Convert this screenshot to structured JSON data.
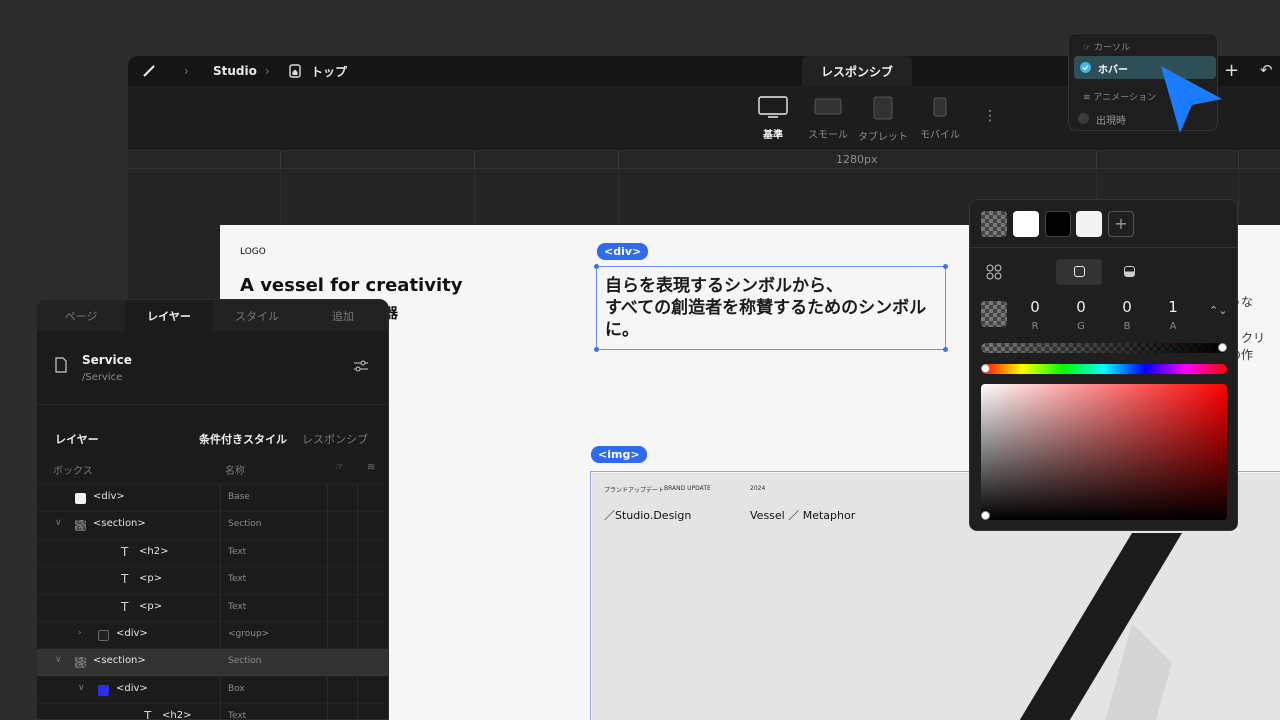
{
  "header": {
    "breadcrumb": [
      "Studio",
      "トップ"
    ],
    "tab_label": "レスポンシブ"
  },
  "devices": [
    {
      "label": "基準",
      "active": true
    },
    {
      "label": "スモール",
      "active": false
    },
    {
      "label": "タブレット",
      "active": false
    },
    {
      "label": "モバイル",
      "active": false
    }
  ],
  "ruler": {
    "width_label": "1280px"
  },
  "page": {
    "logo": "LOGO",
    "headline": "A vessel for creativity",
    "sub_jp": "の器",
    "div_tag": "<div>",
    "div_text_line1": "自らを表現するシンボルから、",
    "div_text_line2": "すべての創造者を称賛するためのシンボル",
    "div_text_line3": "に。",
    "side_text": [
      "のような",
      "スを、クリ",
      "なたの作"
    ],
    "img_tag": "<img>",
    "img": {
      "label_jp": "ブランドアップデート",
      "label_en": "BRAND UPDATE",
      "year": "2024",
      "brand": "／Studio.Design",
      "title": "Vessel ／ Metaphor"
    }
  },
  "left_panel": {
    "tabs": [
      "ページ",
      "レイヤー",
      "スタイル",
      "追加"
    ],
    "active_tab": 1,
    "service": {
      "name": "Service",
      "path": "/Service"
    },
    "section_title": "レイヤー",
    "mode_active": "条件付きスタイル",
    "mode_inactive": "レスポンシブ",
    "col_box": "ボックス",
    "col_name": "名称",
    "rows": [
      {
        "indent": 0,
        "arrow": "",
        "icon": "white",
        "label": "<div>",
        "kind": "Base",
        "sel": false
      },
      {
        "indent": 0,
        "arrow": "∨",
        "icon": "checker",
        "label": "<section>",
        "kind": "Section",
        "sel": false
      },
      {
        "indent": 2,
        "arrow": "",
        "icon": "text",
        "label": "<h2>",
        "kind": "Text",
        "sel": false
      },
      {
        "indent": 2,
        "arrow": "",
        "icon": "text",
        "label": "<p>",
        "kind": "Text",
        "sel": false
      },
      {
        "indent": 2,
        "arrow": "",
        "icon": "text",
        "label": "<p>",
        "kind": "Text",
        "sel": false
      },
      {
        "indent": 1,
        "arrow": "›",
        "icon": "dark",
        "label": "<div>",
        "kind": "<group>",
        "sel": false
      },
      {
        "indent": 0,
        "arrow": "∨",
        "icon": "checker",
        "label": "<section>",
        "kind": "Section",
        "sel": true
      },
      {
        "indent": 1,
        "arrow": "∨",
        "icon": "blue",
        "label": "<div>",
        "kind": "Box",
        "sel": false
      },
      {
        "indent": 3,
        "arrow": "",
        "icon": "text",
        "label": "<h2>",
        "kind": "Text",
        "sel": false
      }
    ]
  },
  "color_picker": {
    "r": "0",
    "g": "0",
    "b": "0",
    "a": "1",
    "r_label": "R",
    "g_label": "G",
    "b_label": "B",
    "a_label": "A"
  },
  "state_popup": {
    "cursor_section": "カーソル",
    "hover": "ホバー",
    "anim_section": "アニメーション",
    "appear": "出現時"
  },
  "colors": {
    "accent": "#2f6bec",
    "cursor": "#1a7cff",
    "hover_bg": "#2f4f56"
  }
}
